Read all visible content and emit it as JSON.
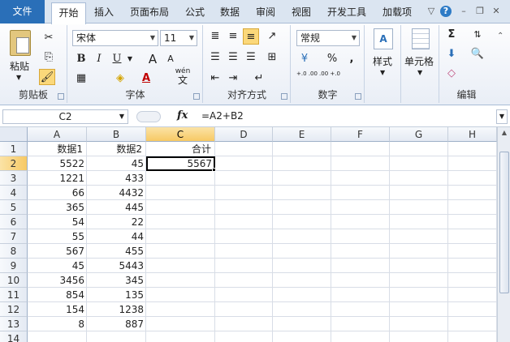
{
  "tabs": [
    "文件",
    "开始",
    "插入",
    "页面布局",
    "公式",
    "数据",
    "审阅",
    "视图",
    "开发工具",
    "加载项"
  ],
  "ribbon": {
    "clipboard": {
      "label": "剪贴板",
      "paste": "粘贴"
    },
    "font": {
      "label": "字体",
      "name": "宋体",
      "size": "11",
      "bold": "B",
      "italic": "I",
      "underline": "U",
      "grow": "A",
      "shrink": "A",
      "color_letter": "A",
      "wen": "wén",
      "wen_char": "文"
    },
    "alignment": {
      "label": "对齐方式"
    },
    "number": {
      "label": "数字",
      "format": "常规",
      "percent": "%",
      "comma": ",",
      "inc": "+.0 .00",
      "dec": ".00 +.0"
    },
    "styles": {
      "label": "样式"
    },
    "cells": {
      "label": "单元格"
    },
    "editing": {
      "label": "编辑"
    }
  },
  "formula_bar": {
    "name_box": "C2",
    "fx": "fx",
    "formula": "=A2+B2"
  },
  "columns": [
    "A",
    "B",
    "C",
    "D",
    "E",
    "F",
    "G",
    "H"
  ],
  "rows": [
    [
      "数据1",
      "数据2",
      "合计"
    ],
    [
      "5522",
      "45",
      "5567"
    ],
    [
      "1221",
      "433",
      ""
    ],
    [
      "66",
      "4432",
      ""
    ],
    [
      "365",
      "445",
      ""
    ],
    [
      "54",
      "22",
      ""
    ],
    [
      "55",
      "44",
      ""
    ],
    [
      "567",
      "455",
      ""
    ],
    [
      "45",
      "5443",
      ""
    ],
    [
      "3456",
      "345",
      ""
    ],
    [
      "854",
      "135",
      ""
    ],
    [
      "154",
      "1238",
      ""
    ],
    [
      "8",
      "887",
      ""
    ],
    [
      "",
      "",
      ""
    ]
  ],
  "colors": {
    "file_tab": "#2a6fb8",
    "selection_header": "#f7c964",
    "active_border": "#000000"
  }
}
